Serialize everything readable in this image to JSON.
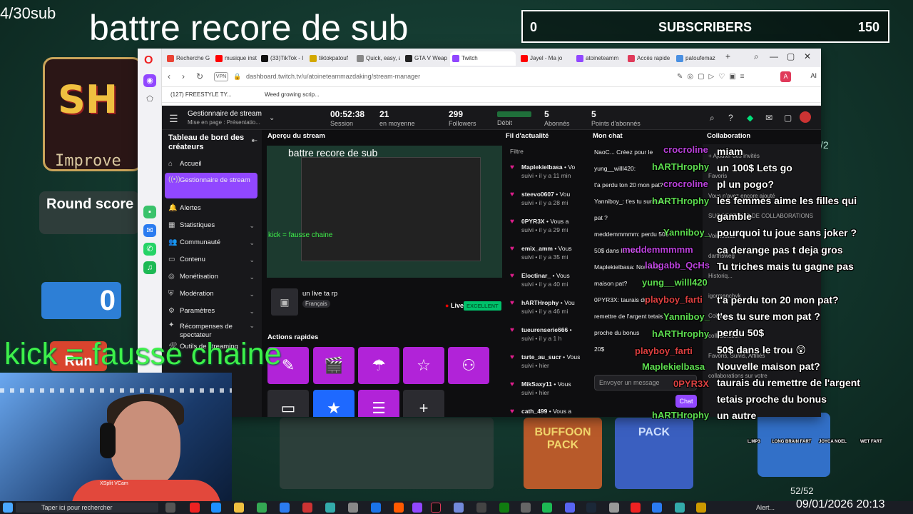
{
  "overlay": {
    "sub_counter": "4/30sub",
    "title": "battre recore de sub",
    "subscribers_left": "0",
    "subscribers_label": "SUBSCRIBERS",
    "subscribers_goal": "150",
    "kick_notice": "kick = fausse chaine"
  },
  "game": {
    "logo_text": "SH",
    "logo_sub": "Improve",
    "round_label": "Round score",
    "score": "0",
    "run_label": "Run",
    "pack1": "BUFFOON PACK",
    "pack2": "PACK",
    "deck_count": "52/52",
    "side_num": "/2"
  },
  "browser": {
    "tabs": [
      {
        "label": "Recherche G",
        "color": "#ea4335"
      },
      {
        "label": "musique inst",
        "color": "#ff0000"
      },
      {
        "label": "(33)TikTok - I",
        "color": "#111111"
      },
      {
        "label": "tiktokpatouf",
        "color": "#d3a800"
      },
      {
        "label": "Quick, easy, a",
        "color": "#888888"
      },
      {
        "label": "GTA V Weap",
        "color": "#222222"
      },
      {
        "label": "Twitch",
        "color": "#9147ff"
      },
      {
        "label": "Jayel - Ma jo",
        "color": "#ff0000"
      },
      {
        "label": "atoineteamm",
        "color": "#9147ff"
      },
      {
        "label": "Accès rapide",
        "color": "#e03a5a"
      },
      {
        "label": "patoufemaz",
        "color": "#4a90e2"
      }
    ],
    "url": "dashboard.twitch.tv/u/atoineteammazdaking/stream-manager",
    "vpn": "VPN",
    "ai_label": "AI",
    "bookmarks": [
      "(127) FREESTYLE TY...",
      "Weed growing scrip..."
    ]
  },
  "dashboard": {
    "header_title": "Gestionnaire de stream",
    "header_sub": "Mise en page : Présentatio...",
    "stats": [
      {
        "value": "00:52:38",
        "label": "Session"
      },
      {
        "value": "21",
        "label": "en moyenne"
      },
      {
        "value": "299",
        "label": "Followers"
      },
      {
        "value": "",
        "label": "Débit"
      },
      {
        "value": "5",
        "label": "Abonnés"
      },
      {
        "value": "5",
        "label": "Points d'abonnés"
      }
    ],
    "nav_heading": "Tableau de bord des créateurs",
    "nav": [
      {
        "label": "Accueil",
        "icon": "⌂",
        "chev": ""
      },
      {
        "label": "Gestionnaire de stream",
        "icon": "((•))",
        "chev": ""
      },
      {
        "label": "Alertes",
        "icon": "🔔",
        "chev": ""
      },
      {
        "label": "Statistiques",
        "icon": "▦",
        "chev": "⌄"
      },
      {
        "label": "Communauté",
        "icon": "👥",
        "chev": "⌄"
      },
      {
        "label": "Contenu",
        "icon": "▭",
        "chev": "⌄"
      },
      {
        "label": "Monétisation",
        "icon": "◎",
        "chev": "⌄"
      },
      {
        "label": "Modération",
        "icon": "⛨",
        "chev": "⌄"
      },
      {
        "label": "Paramètres",
        "icon": "⚙",
        "chev": "⌄"
      },
      {
        "label": "Récompenses de spectateur",
        "icon": "✦",
        "chev": "⌄"
      },
      {
        "label": "Outils de streaming",
        "icon": "🛠",
        "chev": ""
      }
    ],
    "panels": {
      "preview": "Aperçu du stream",
      "feed": "Fil d'actualité",
      "chat": "Mon chat",
      "collab": "Collaboration",
      "quick_actions": "Actions rapides",
      "feed_filter": "Filtre"
    },
    "preview_title": "battre recore de sub",
    "preview_kick": "kick = fausse chaine",
    "stream_title": "un live ta rp",
    "stream_lang": "Français",
    "live_label": "Live",
    "quality": "EXCELLENT",
    "feed": [
      {
        "name": "Maplekielbasa",
        "text": "• Vo",
        "time": "suivi • il y a 11 min"
      },
      {
        "name": "steevo0607",
        "text": "• Vou",
        "time": "suivi • il y a 28 mi"
      },
      {
        "name": "0PYR3X",
        "text": "• Vous a",
        "time": "suivi • il y a 29 mi"
      },
      {
        "name": "emix_amm",
        "text": "• Vous",
        "time": "suivi • il y a 35 mi"
      },
      {
        "name": "Eloctinar_",
        "text": "• Vous",
        "time": "suivi • il y a 40 mi"
      },
      {
        "name": "hARTHrophy",
        "text": "• Vou",
        "time": "suivi • il y a 46 mi"
      },
      {
        "name": "tueurenserie666",
        "text": "•",
        "time": "suivi • il y a 1 h"
      },
      {
        "name": "tarte_au_sucr",
        "text": "• Vous",
        "time": "suivi • hier"
      },
      {
        "name": "MikSaxy11",
        "text": "• Vous",
        "time": "suivi • hier"
      },
      {
        "name": "cath_499",
        "text": "• Vous a",
        "time": ""
      }
    ],
    "chat": [
      "NaoC...  Créez pour le",
      "yung__willl420:",
      "t'a perdu ton 20 mon pat?",
      "Yanniboy_: t'es tu sure mon",
      "pat ?",
      "meddemmmmm: perdu 50$",
      "50$ dans le trou",
      "Maplekielbasa: Nouvelle",
      "maison pat?",
      "0PYR3X: taurais du",
      "remettre de l'argent tetais",
      "proche du bonus",
      "20$"
    ],
    "chat_input": "Envoyer un message",
    "chat_btn": "Chat",
    "collab_lines": [
      "+ Ajouter des invités",
      "Favoris",
      "Vous n'avez encore ajouté",
      "SUGGESTIONS DE COLLABORATIONS",
      "Voir toutes",
      "darthsweg",
      "Historiq...",
      "igormanchyk",
      "Collabor...",
      "collaboration",
      "Favoris, Suivis, Affiliés",
      "collaborations sur votre"
    ]
  },
  "chat_overlay": [
    {
      "text": "miam",
      "style": ""
    },
    {
      "text": "un 100$ Lets go",
      "style": ""
    },
    {
      "text": "pl un pogo?",
      "style": ""
    },
    {
      "text": "les femmes aime les filles qui",
      "style": ""
    },
    {
      "text": "gamble",
      "style": ""
    },
    {
      "text": "pourquoi tu joue sans joker ?",
      "style": ""
    },
    {
      "text": "ca derange pas t deja gros",
      "style": ""
    },
    {
      "text": "Tu triches mais tu gagne pas",
      "style": ""
    },
    {
      "text": "t'a perdu ton 20 mon pat?",
      "style": ""
    },
    {
      "text": "t'es tu sure mon pat ?",
      "style": ""
    },
    {
      "text": "perdu 50$",
      "style": ""
    },
    {
      "text": "50$ dans le trou 😲",
      "style": ""
    },
    {
      "text": "Nouvelle maison pat?",
      "style": ""
    },
    {
      "text": "taurais du remettre de l'argent",
      "style": ""
    },
    {
      "text": "tetais proche du bonus",
      "style": ""
    },
    {
      "text": "un autre",
      "style": ""
    }
  ],
  "chat_overlay_names": [
    {
      "text": "crocroline",
      "style": "p"
    },
    {
      "text": "hARTHrophy",
      "style": "g"
    },
    {
      "text": "crocroline",
      "style": "p"
    },
    {
      "text": "hARTHrophy",
      "style": "g"
    },
    {
      "text": "Yanniboy_",
      "style": "g"
    },
    {
      "text": "meddemmmmm",
      "style": "p"
    },
    {
      "text": "labgabb_QcHs",
      "style": "p"
    },
    {
      "text": "yung__willl420",
      "style": "g"
    },
    {
      "text": "playboy_farti",
      "style": "r"
    },
    {
      "text": "Yanniboy_",
      "style": "g"
    },
    {
      "text": "hARTHrophy",
      "style": "g"
    },
    {
      "text": "playboy_farti",
      "style": "r"
    },
    {
      "text": "Maplekielbasa",
      "style": "g"
    },
    {
      "text": "0PYR3X",
      "style": "r"
    },
    {
      "text": "hARTHrophy",
      "style": "g"
    }
  ],
  "reactions": [
    "LONG BRAIN FART",
    "JOYCA NOEL",
    "WET FART",
    "L.MP3"
  ],
  "webcam": {
    "tag": "XSplit VCam"
  },
  "taskbar": {
    "search": "Taper ici pour rechercher",
    "alert": "Alert...",
    "datetime": "09/01/2026 20:13"
  }
}
